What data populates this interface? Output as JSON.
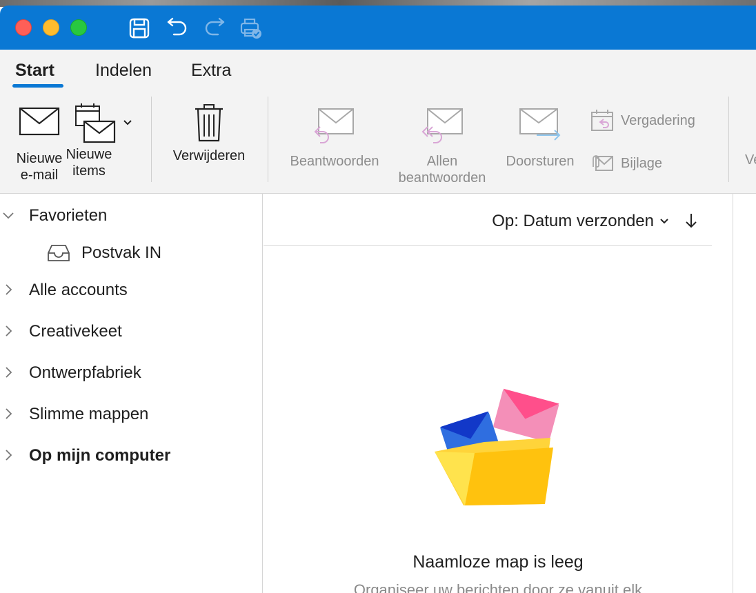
{
  "ribbon": {
    "tabs": [
      {
        "label": "Start",
        "active": true
      },
      {
        "label": "Indelen",
        "active": false
      },
      {
        "label": "Extra",
        "active": false
      }
    ],
    "new_email": {
      "line1": "Nieuwe",
      "line2": "e-mail"
    },
    "new_items": {
      "line1": "Nieuwe",
      "line2": "items"
    },
    "delete": {
      "label": "Verwijderen"
    },
    "reply": {
      "label": "Beantwoorden"
    },
    "reply_all": {
      "line1": "Allen",
      "line2": "beantwoorden"
    },
    "forward": {
      "label": "Doorsturen"
    },
    "meeting": {
      "label": "Vergadering"
    },
    "attachment": {
      "label": "Bijlage"
    },
    "cut_off_label": "Ve"
  },
  "sidebar": {
    "favorites": "Favorieten",
    "inbox": "Postvak IN",
    "items": [
      {
        "label": "Alle accounts",
        "bold": false
      },
      {
        "label": "Creativekeet",
        "bold": false
      },
      {
        "label": "Ontwerpfabriek",
        "bold": false
      },
      {
        "label": "Slimme mappen",
        "bold": false
      },
      {
        "label": "Op mijn computer",
        "bold": true
      }
    ]
  },
  "list": {
    "sort_label": "Op: Datum verzonden",
    "empty_title": "Naamloze map is leeg",
    "empty_subtitle": "Organiseer uw berichten door ze vanuit elk"
  },
  "colors": {
    "accent": "#0a78d4",
    "disabled_text": "#8c8c8c"
  }
}
